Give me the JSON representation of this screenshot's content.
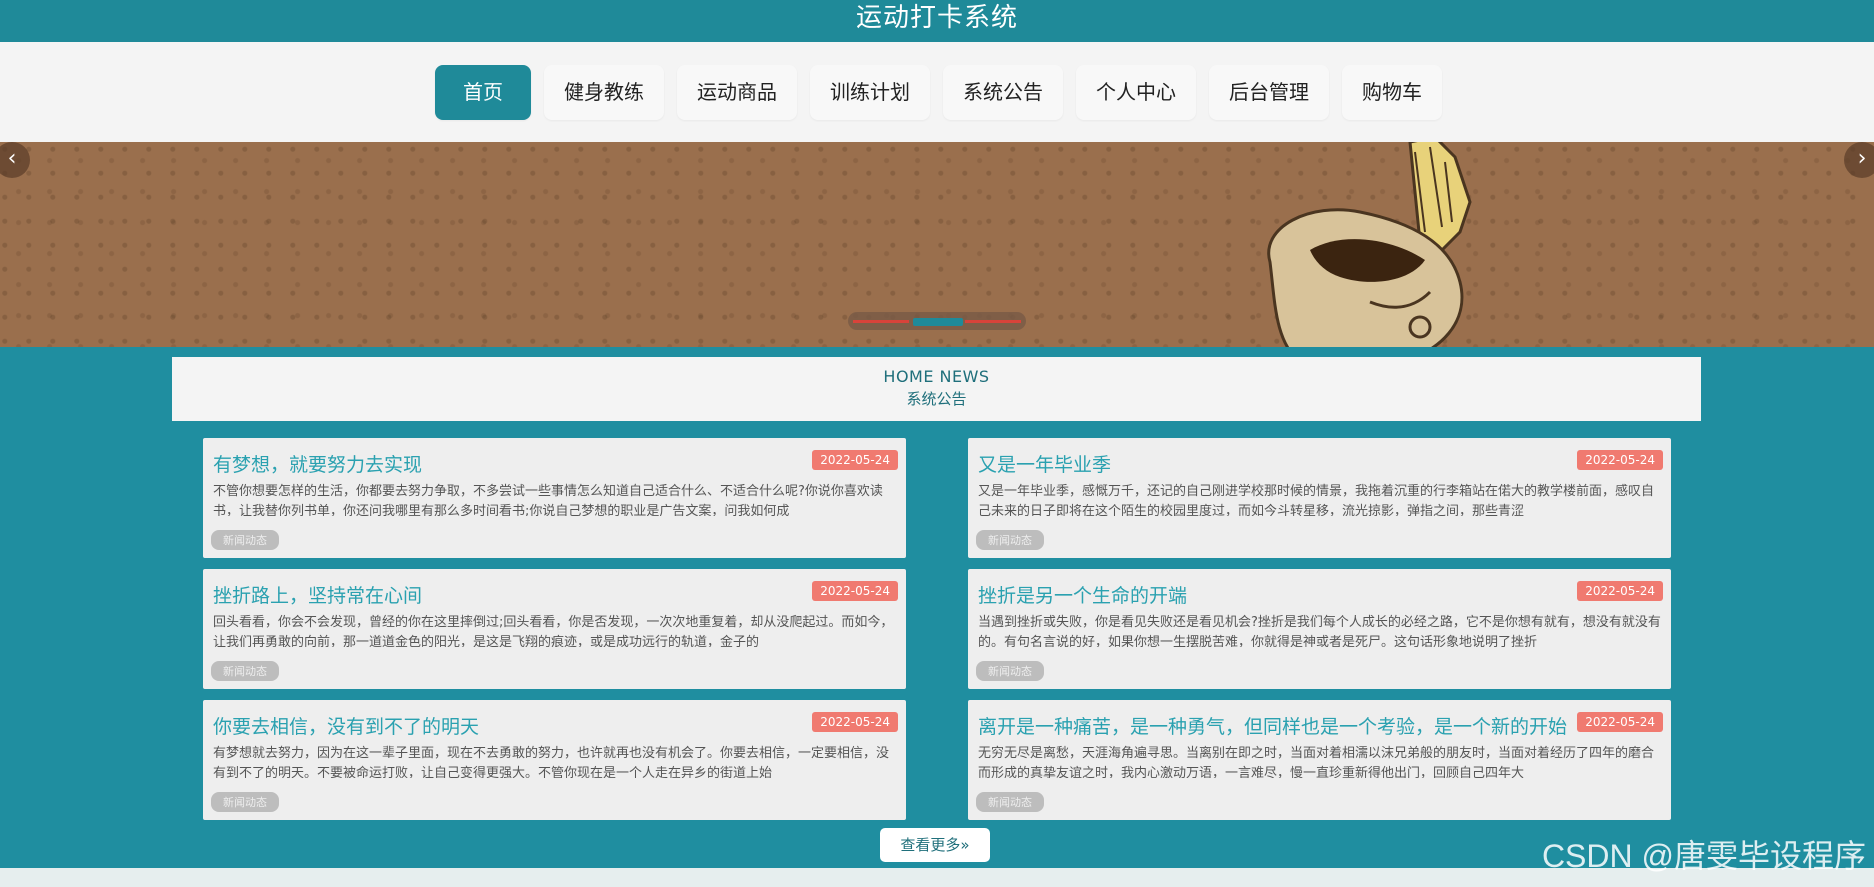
{
  "header": {
    "title": "运动打卡系统"
  },
  "nav": {
    "items": [
      {
        "label": "首页",
        "active": true
      },
      {
        "label": "健身教练"
      },
      {
        "label": "运动商品"
      },
      {
        "label": "训练计划"
      },
      {
        "label": "系统公告"
      },
      {
        "label": "个人中心"
      },
      {
        "label": "后台管理"
      },
      {
        "label": "购物车"
      }
    ]
  },
  "banner": {
    "prev_icon": "chevron-left-icon",
    "next_icon": "chevron-right-icon",
    "prev_glyph": "‹",
    "next_glyph": "›",
    "active_slide": 2,
    "slide_count": 3
  },
  "news": {
    "en_title": "HOME NEWS",
    "zh_title": "系统公告",
    "items": [
      {
        "title": "有梦想，就要努力去实现",
        "date": "2022-05-24",
        "summary": "不管你想要怎样的生活，你都要去努力争取，不多尝试一些事情怎么知道自己适合什么、不适合什么呢?你说你喜欢读书，让我替你列书单，你还问我哪里有那么多时间看书;你说自己梦想的职业是广告文案，问我如何成",
        "tag": "新闻动态"
      },
      {
        "title": "又是一年毕业季",
        "date": "2022-05-24",
        "summary": "又是一年毕业季，感慨万千，还记的自己刚进学校那时候的情景，我拖着沉重的行李箱站在偌大的教学楼前面，感叹自己未来的日子即将在这个陌生的校园里度过，而如今斗转星移，流光掠影，弹指之间，那些青涩",
        "tag": "新闻动态"
      },
      {
        "title": "挫折路上，坚持常在心间",
        "date": "2022-05-24",
        "summary": "回头看看，你会不会发现，曾经的你在这里摔倒过;回头看看，你是否发现，一次次地重复着，却从没爬起过。而如今，让我们再勇敢的向前，那一道道金色的阳光，是这是飞翔的痕迹，或是成功远行的轨道，金子的",
        "tag": "新闻动态"
      },
      {
        "title": "挫折是另一个生命的开端",
        "date": "2022-05-24",
        "summary": "当遇到挫折或失败，你是看见失败还是看见机会?挫折是我们每个人成长的必经之路，它不是你想有就有，想没有就没有的。有句名言说的好，如果你想一生摆脱苦难，你就得是神或者是死尸。这句话形象地说明了挫折",
        "tag": "新闻动态"
      },
      {
        "title": "你要去相信，没有到不了的明天",
        "date": "2022-05-24",
        "summary": "有梦想就去努力，因为在这一辈子里面，现在不去勇敢的努力，也许就再也没有机会了。你要去相信，一定要相信，没有到不了的明天。不要被命运打败，让自己变得更强大。不管你现在是一个人走在异乡的街道上始",
        "tag": "新闻动态"
      },
      {
        "title": "离开是一种痛苦，是一种勇气，但同样也是一个考验，是一个新的开始",
        "date": "2022-05-24",
        "summary": "无穷无尽是离愁，天涯海角遍寻思。当离别在即之时，当面对着相濡以沫兄弟般的朋友时，当面对着经历了四年的磨合而形成的真挚友谊之时，我内心激动万语，一言难尽，慢一直珍重新得他出门，回顾自己四年大",
        "tag": "新闻动态"
      }
    ]
  },
  "more_button": {
    "label": "查看更多»"
  },
  "watermark": {
    "text": "CSDN @唐雯毕设程序"
  },
  "colors": {
    "primary": "#1f8a99",
    "date_badge": "#f07a70",
    "title_text": "#2aa1b0"
  }
}
